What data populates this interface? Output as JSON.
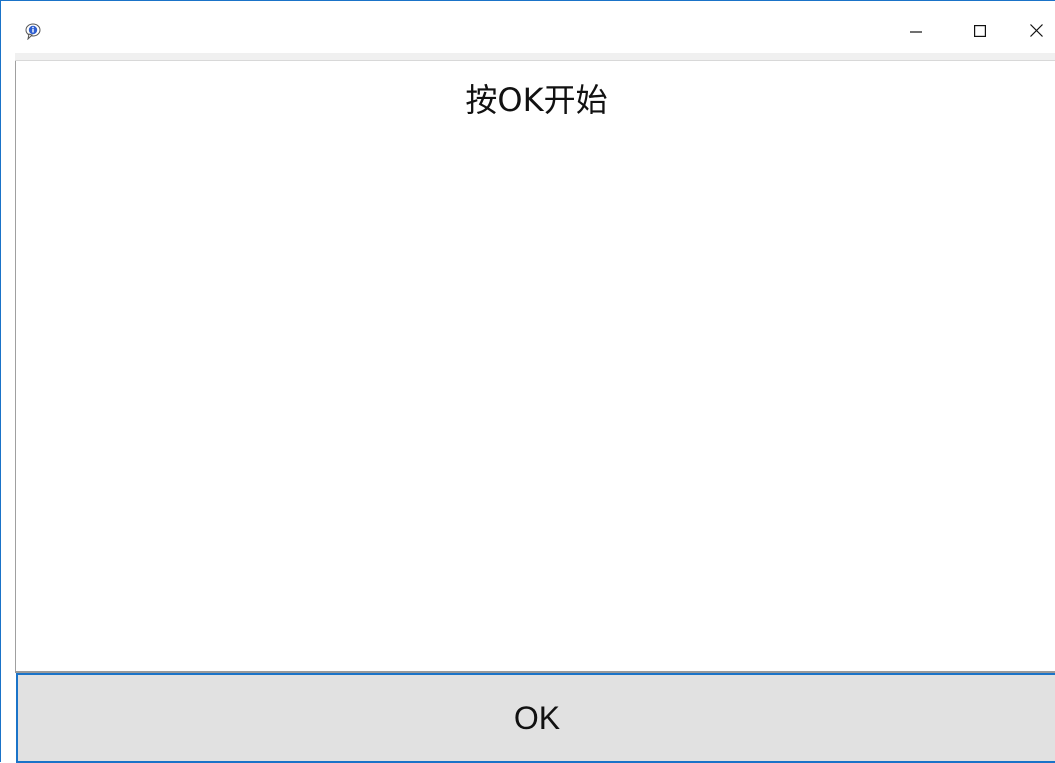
{
  "window": {
    "title": "",
    "icon": "info-balloon-icon",
    "controls": {
      "minimize_icon": "minimize-icon",
      "maximize_icon": "maximize-icon",
      "close_icon": "close-icon"
    }
  },
  "main": {
    "prompt_text": "按OK开始"
  },
  "footer": {
    "ok_label": "OK"
  },
  "colors": {
    "accent": "#1a73c8",
    "button_bg": "#e1e1e1",
    "content_bg": "#ffffff"
  }
}
